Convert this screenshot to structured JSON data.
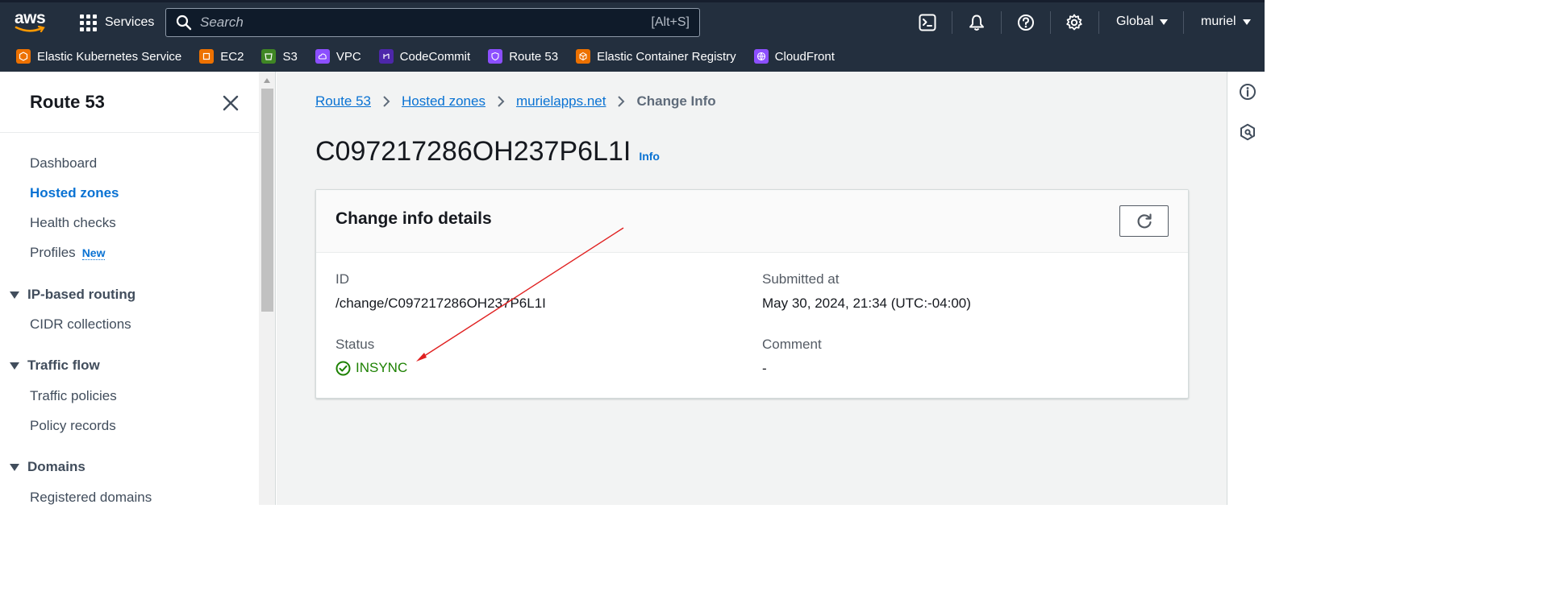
{
  "topbar": {
    "logo_text": "aws",
    "services_label": "Services",
    "search_placeholder": "Search",
    "search_shortcut": "[Alt+S]",
    "region_label": "Global",
    "user_label": "muriel"
  },
  "favorites": [
    {
      "label": "Elastic Kubernetes Service",
      "color": "#ed7100"
    },
    {
      "label": "EC2",
      "color": "#ed7100"
    },
    {
      "label": "S3",
      "color": "#3f8624"
    },
    {
      "label": "VPC",
      "color": "#8c4fff"
    },
    {
      "label": "CodeCommit",
      "color": "#4d27aa"
    },
    {
      "label": "Route 53",
      "color": "#8c4fff"
    },
    {
      "label": "Elastic Container Registry",
      "color": "#ed7100"
    },
    {
      "label": "CloudFront",
      "color": "#8c4fff"
    }
  ],
  "sidebar": {
    "title": "Route 53",
    "items": {
      "dashboard": "Dashboard",
      "hosted_zones": "Hosted zones",
      "health_checks": "Health checks",
      "profiles": "Profiles",
      "profiles_badge": "New",
      "ip_routing": "IP-based routing",
      "cidr": "CIDR collections",
      "traffic_flow": "Traffic flow",
      "traffic_policies": "Traffic policies",
      "policy_records": "Policy records",
      "domains": "Domains",
      "registered_domains": "Registered domains"
    }
  },
  "breadcrumb": [
    "Route 53",
    "Hosted zones",
    "murielapps.net",
    "Change Info"
  ],
  "page": {
    "title": "C097217286OH237P6L1I",
    "info_link": "Info"
  },
  "card": {
    "title": "Change info details",
    "id_label": "ID",
    "id_value": "/change/C097217286OH237P6L1I",
    "submitted_label": "Submitted at",
    "submitted_value": "May 30, 2024, 21:34 (UTC:-04:00)",
    "status_label": "Status",
    "status_value": "INSYNC",
    "comment_label": "Comment",
    "comment_value": "-"
  },
  "colors": {
    "nav_bg": "#232f3e",
    "link": "#0972d3",
    "success": "#1d8102",
    "annotation": "#e02020"
  }
}
